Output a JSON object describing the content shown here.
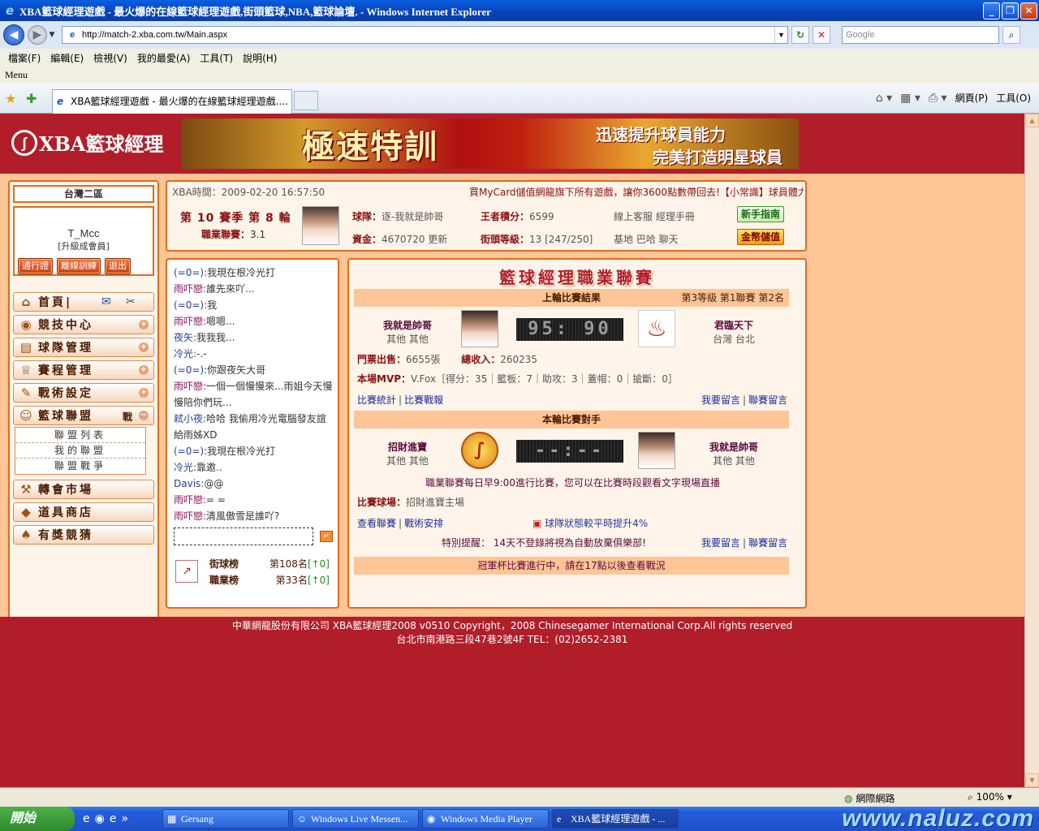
{
  "window": {
    "title": "XBA籃球經理遊戲 - 最火爆的在線籃球經理遊戲,街頭籃球,NBA,籃球論壇. - Windows Internet Explorer",
    "min": "_",
    "max": "❐",
    "close": "✕"
  },
  "addressbar": {
    "url": "http://match-2.xba.com.tw/Main.aspx",
    "search_placeholder": "Google"
  },
  "menu": [
    "檔案(F)",
    "編輯(E)",
    "檢視(V)",
    "我的最愛(A)",
    "工具(T)",
    "說明(H)"
  ],
  "menu_label": "Menu",
  "tab": {
    "title": "XBA籃球經理遊戲 - 最火爆的在線籃球經理遊戲...."
  },
  "commandbar": {
    "page": "網頁(P)",
    "tools": "工具(O)"
  },
  "site": {
    "logo_text": "XBA籃球經理",
    "banner": {
      "headline": "極速特訓",
      "line1": "迅速提升球員能力",
      "line2": "完美打造明星球員"
    }
  },
  "sidebar": {
    "server": "台灣二區",
    "user": {
      "name": "T_Mcc",
      "level": "[升級成會員]"
    },
    "buttons": [
      "通行證",
      "離線訓練",
      "退出"
    ],
    "nav": [
      {
        "label": "首頁|",
        "icon": "⌂"
      },
      {
        "label": "競技中心",
        "icon": "◉"
      },
      {
        "label": "球隊管理",
        "icon": "▤"
      },
      {
        "label": "賽程管理",
        "icon": "♕"
      },
      {
        "label": "戰術設定",
        "icon": "✎"
      },
      {
        "label": "籃球聯盟",
        "icon": "☺",
        "extra": "戰"
      }
    ],
    "subnav": [
      "聯盟列表",
      "我的聯盟",
      "聯盟戰爭"
    ],
    "nav2": [
      {
        "label": "轉會市場",
        "icon": "⚒"
      },
      {
        "label": "道具商店",
        "icon": "◆"
      },
      {
        "label": "有獎競猜",
        "icon": "♠"
      }
    ]
  },
  "info": {
    "time": "XBA時間：2009-02-20 16:57:50",
    "ticker": "買MyCard儲值網龍旗下所有遊戲，讓你3600點數帶回去!【小常識】球員體力",
    "season": "第 10 賽季  第 8 輪",
    "league_label": "職業聯賽：",
    "league_value": "3.1",
    "team_label": "球隊：",
    "team_value": "逐-我就是帥哥",
    "score_label": "王者積分：",
    "score_value": "6599",
    "funds_label": "資金：",
    "funds_value": "4670720",
    "refresh": "更新",
    "street_label": "街頭等級：",
    "street_value": "13 [247/250]",
    "links1": "線上客服  經理手冊",
    "links2": "基地  巴哈  聊天",
    "guide_btn": "新手指南",
    "topup_btn": "金幣儲值"
  },
  "chat": {
    "messages": [
      {
        "name": "(=0=):",
        "text": "我現在根冷光打",
        "c": "n1"
      },
      {
        "name": "雨吓戀:",
        "text": "誰先來吖...",
        "c": "n2"
      },
      {
        "name": "(=0=):",
        "text": "我",
        "c": "n1"
      },
      {
        "name": "雨吓戀:",
        "text": "嗯嗯...",
        "c": "n2"
      },
      {
        "name": "夜矢:",
        "text": "我我我...",
        "c": "n1"
      },
      {
        "name": "冷光:",
        "text": "-.-",
        "c": "n1"
      },
      {
        "name": "(=0=):",
        "text": "你跟夜矢大哥",
        "c": "n1"
      },
      {
        "name": "雨吓戀:",
        "text": "一個一個慢慢來...雨姐今天慢慢陪你們玩...",
        "c": "n2"
      },
      {
        "name": "弒小夜:",
        "text": "哈哈  我偷用冷光電腦發友誼給雨姊XD",
        "c": "n1"
      },
      {
        "name": "(=0=):",
        "text": "我現在根冷光打",
        "c": "n1"
      },
      {
        "name": "冷光:",
        "text": "靠邀..",
        "c": "n1"
      },
      {
        "name": "Davis:",
        "text": "@@",
        "c": "n1"
      },
      {
        "name": "雨吓戀:",
        "text": "= =",
        "c": "n2"
      },
      {
        "name": "雨吓戀:",
        "text": "清風傲雪是誰吖?",
        "c": "n2"
      }
    ],
    "send": "↵"
  },
  "rank": {
    "street_label": "街球榜",
    "street_value": "第108名",
    "street_delta": "[↑0]",
    "pro_label": "職業榜",
    "pro_value": "第33名",
    "pro_delta": "[↑0]"
  },
  "league": {
    "title": "籃球經理職業聯賽",
    "last": {
      "header": "上輪比賽結果",
      "info": "第3等級  第1聯賽  第2名",
      "home": {
        "name": "我就是帥哥",
        "loc": "其他  其他"
      },
      "score": "95: 90",
      "away": {
        "name": "君臨天下",
        "loc": "台灣  台北"
      },
      "tickets_label": "門票出售：",
      "tickets_value": "6655張",
      "revenue_label": "總收入：",
      "revenue_value": "260235",
      "mvp_label": "本場MVP：",
      "mvp_value": "V.Fox［得分：35｜籃板：7｜助攻：3｜蓋帽：0｜搶斷：0］",
      "stats": "比賽統計",
      "report": "比賽戰報",
      "msg": "我要留言",
      "leaguemsg": "聯賽留言"
    },
    "next": {
      "header": "本輪比賽對手",
      "home": {
        "name": "招財進寶",
        "loc": "其他  其他"
      },
      "score": "--:--",
      "away": {
        "name": "我就是帥哥",
        "loc": "其他  其他"
      },
      "note": "職業聯賽每日早9:00進行比賽，您可以在比賽時段觀看文字現場直播",
      "venue_label": "比賽球場：",
      "venue_value": "招財進寶主場",
      "view": "查看聯賽",
      "tactics": "戰術安排",
      "status": "球隊狀態較平時提升4%",
      "reminder": "特別提醒：  14天不登錄將視為自動放棄俱樂部!",
      "msg": "我要留言",
      "leaguemsg": "聯賽留言"
    },
    "cup_notice": "冠軍杯比賽進行中，請在17點以後查看戰況"
  },
  "footer": {
    "line1": "中華網龍股份有限公司  XBA籃球經理2008 v0510     Copyright，2008 Chinesegamer International Corp.All rights reserved",
    "line2": "台北市南港路三段47巷2號4F TEL：(02)2652-2381"
  },
  "status": {
    "zone": "網際網路",
    "zoom": "100%"
  },
  "taskbar": {
    "start": "開始",
    "tasks": [
      "Gersang",
      "Windows Live Messen...",
      "Windows Media Player",
      "XBA籃球經理遊戲 - ..."
    ],
    "watermark": "www.naluz.com"
  }
}
